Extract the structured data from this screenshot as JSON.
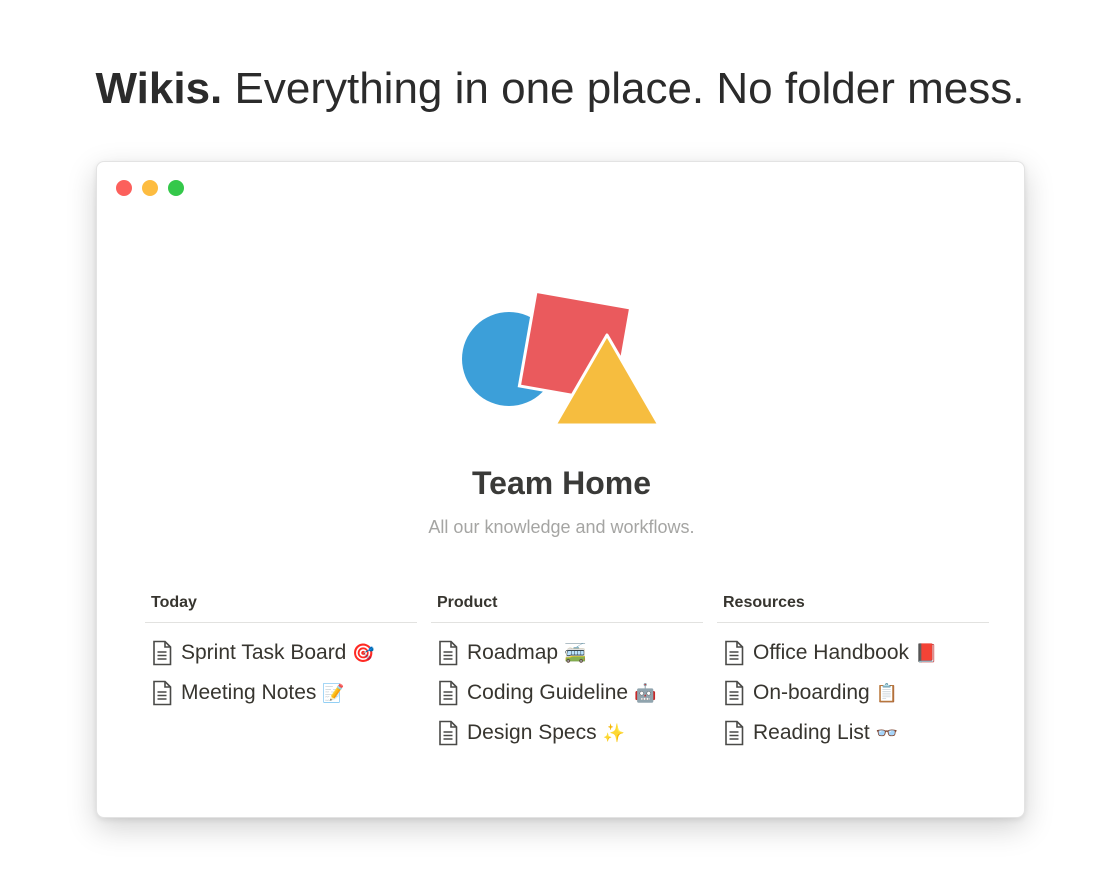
{
  "headline": {
    "bold": "Wikis.",
    "rest": "Everything in one place. No folder mess."
  },
  "window": {
    "traffic_lights": {
      "close_color": "#fc605c",
      "minimize_color": "#fdbc40",
      "zoom_color": "#34c84a"
    }
  },
  "page": {
    "title": "Team Home",
    "subtitle": "All our knowledge and workflows.",
    "logo_colors": {
      "circle": "#3c9fd9",
      "square": "#ea5a5d",
      "triangle": "#f6bd3f"
    }
  },
  "columns": [
    {
      "header": "Today",
      "items": [
        {
          "label": "Sprint Task Board",
          "emoji": "🎯",
          "icon": "page-icon"
        },
        {
          "label": "Meeting Notes",
          "emoji": "📝",
          "icon": "page-icon"
        }
      ]
    },
    {
      "header": "Product",
      "items": [
        {
          "label": "Roadmap",
          "emoji": "🚎",
          "icon": "page-icon"
        },
        {
          "label": "Coding Guideline",
          "emoji": "🤖",
          "icon": "page-icon"
        },
        {
          "label": "Design Specs",
          "emoji": "✨",
          "icon": "page-icon"
        }
      ]
    },
    {
      "header": "Resources",
      "items": [
        {
          "label": "Office Handbook",
          "emoji": "📕",
          "icon": "page-icon"
        },
        {
          "label": "On-boarding",
          "emoji": "📋",
          "icon": "page-icon"
        },
        {
          "label": "Reading List",
          "emoji": "👓",
          "icon": "page-icon"
        }
      ]
    }
  ]
}
